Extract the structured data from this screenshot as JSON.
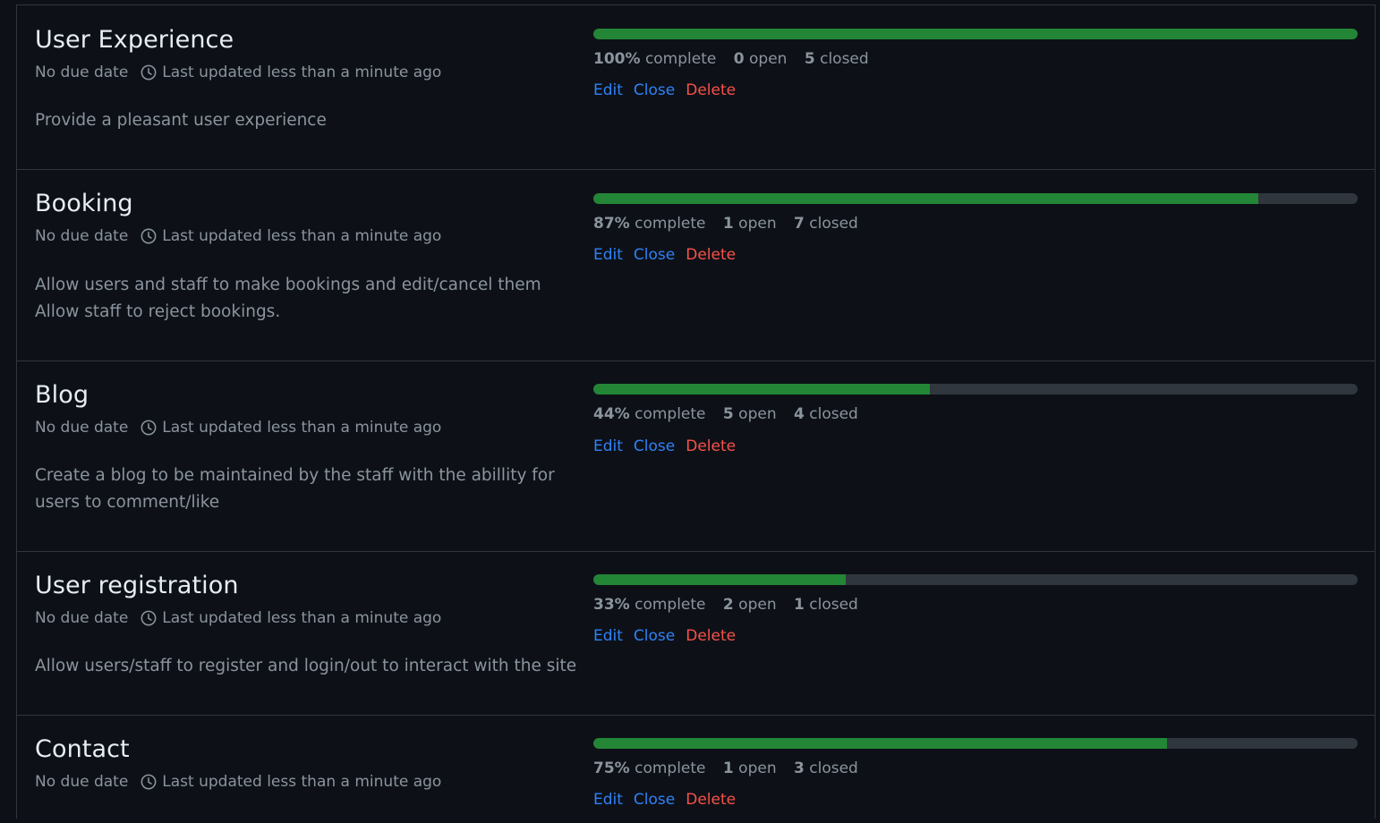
{
  "colors": {
    "background": "#0d1117",
    "border": "#30363d",
    "progress_fill": "#238636",
    "progress_track": "#30363d",
    "link": "#2f81f7",
    "danger": "#f85149",
    "muted": "#8b949e"
  },
  "labels": {
    "no_due_date": "No due date",
    "last_updated": "Last updated less than a minute ago",
    "complete_suffix": "complete",
    "open_suffix": "open",
    "closed_suffix": "closed",
    "edit": "Edit",
    "close": "Close",
    "delete": "Delete"
  },
  "milestones": [
    {
      "title": "User Experience",
      "description": [
        "Provide a pleasant user experience"
      ],
      "percent": 100,
      "percent_label": "100%",
      "open": "0",
      "closed": "5"
    },
    {
      "title": "Booking",
      "description": [
        "Allow users and staff to make bookings and edit/cancel them",
        "Allow staff to reject bookings."
      ],
      "percent": 87,
      "percent_label": "87%",
      "open": "1",
      "closed": "7"
    },
    {
      "title": "Blog",
      "description": [
        "Create a blog to be maintained by the staff with the abillity for",
        "users to comment/like"
      ],
      "percent": 44,
      "percent_label": "44%",
      "open": "5",
      "closed": "4"
    },
    {
      "title": "User registration",
      "description": [
        "Allow users/staff to register and login/out to interact with the site"
      ],
      "percent": 33,
      "percent_label": "33%",
      "open": "2",
      "closed": "1"
    },
    {
      "title": "Contact",
      "description": [],
      "percent": 75,
      "percent_label": "75%",
      "open": "1",
      "closed": "3"
    }
  ]
}
